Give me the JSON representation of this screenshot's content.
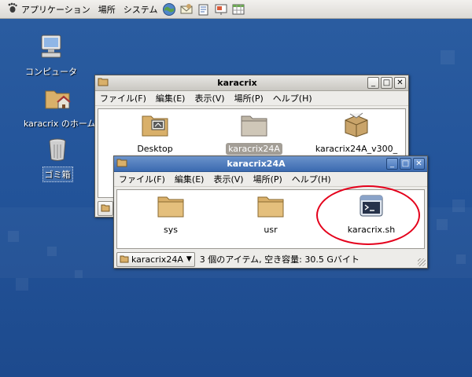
{
  "panel": {
    "menus": [
      "アプリケーション",
      "場所",
      "システム"
    ],
    "launchers": [
      "browser-icon",
      "mail-icon",
      "writer-icon",
      "presentation-icon",
      "spreadsheet-icon"
    ]
  },
  "desktop": {
    "icons": [
      {
        "label": "コンピュータ",
        "icon": "computer-icon"
      },
      {
        "label": "karacrix のホーム",
        "icon": "home-folder-icon"
      },
      {
        "label": "ゴミ箱",
        "icon": "trash-icon"
      }
    ]
  },
  "window_home": {
    "title": "karacrix",
    "menu": [
      "ファイル(F)",
      "編集(E)",
      "表示(V)",
      "場所(P)",
      "ヘルプ(H)"
    ],
    "items": [
      {
        "label": "Desktop",
        "icon": "desktop-folder-icon"
      },
      {
        "label": "karacrix24A",
        "icon": "folder-icon",
        "selected": true
      },
      {
        "label": "karacrix24A_v300_",
        "icon": "package-icon"
      }
    ]
  },
  "window_folder": {
    "title": "karacrix24A",
    "menu": [
      "ファイル(F)",
      "編集(E)",
      "表示(V)",
      "場所(P)",
      "ヘルプ(H)"
    ],
    "items": [
      {
        "label": "sys",
        "icon": "folder-icon"
      },
      {
        "label": "usr",
        "icon": "folder-icon"
      },
      {
        "label": "karacrix.sh",
        "icon": "shell-script-icon"
      }
    ],
    "location": "karacrix24A",
    "status": "3 個のアイテム, 空き容量: 30.5 Gバイト"
  },
  "colors": {
    "desktop": "#23549a",
    "active_title": "#3b6ab0",
    "annotation": "#e4001b",
    "folder": "#d9b06a"
  }
}
